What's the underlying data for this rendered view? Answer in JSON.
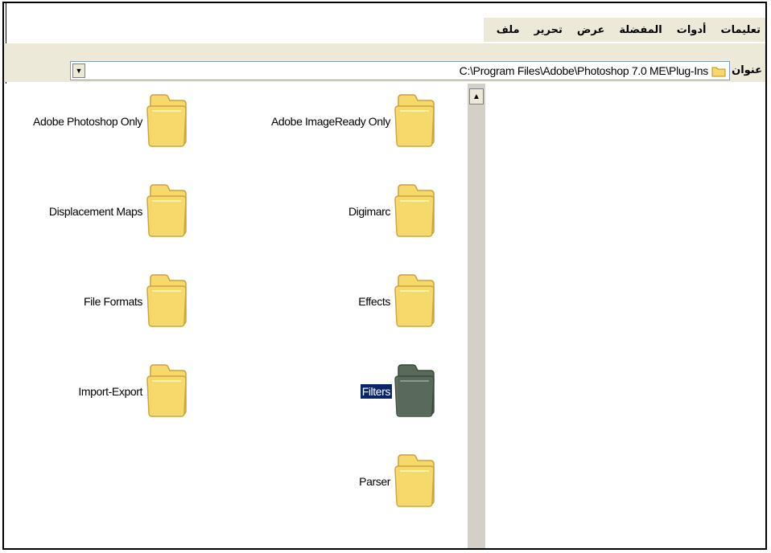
{
  "menu": {
    "items": [
      "ملف",
      "تحرير",
      "عرض",
      "المفضلة",
      "أدوات",
      "تعليمات"
    ]
  },
  "address": {
    "label": "عنوان",
    "path": "C:\\Program Files\\Adobe\\Photoshop 7.0 ME\\Plug-Ins"
  },
  "folders": [
    {
      "name": "Adobe Photoshop Only",
      "selected": false
    },
    {
      "name": "Adobe ImageReady Only",
      "selected": false
    },
    {
      "name": "Displacement Maps",
      "selected": false
    },
    {
      "name": "Digimarc",
      "selected": false
    },
    {
      "name": "File Formats",
      "selected": false
    },
    {
      "name": "Effects",
      "selected": false
    },
    {
      "name": "Import-Export",
      "selected": false
    },
    {
      "name": "Filters",
      "selected": true
    },
    {
      "name": "Parser",
      "selected": false
    }
  ],
  "colors": {
    "folder_fill": "#f7d96b",
    "folder_selected_fill": "#5a6a5a",
    "selection": "#0a246a"
  },
  "icons": {
    "folder": "folder-icon",
    "dropdown": "dropdown-arrow-icon",
    "scroll_up": "scroll-up-arrow-icon"
  }
}
